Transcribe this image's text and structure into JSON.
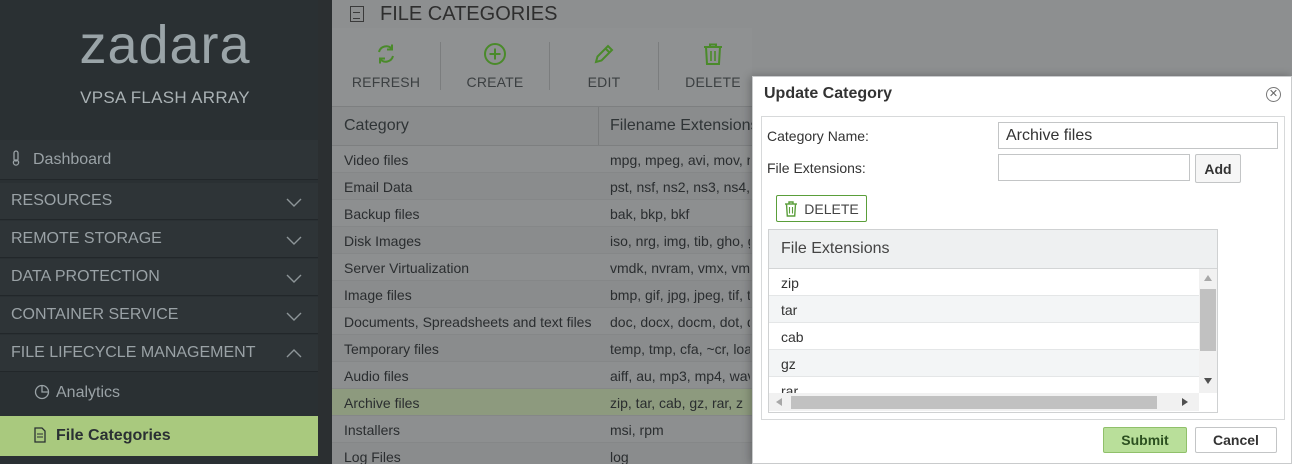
{
  "sidebar": {
    "logo": "zadara",
    "subtitle": "VPSA FLASH ARRAY",
    "items": [
      {
        "label": "Dashboard",
        "icon": "thermometer-icon"
      },
      {
        "label": "RESOURCES",
        "icon": "chevron-down-icon"
      },
      {
        "label": "REMOTE STORAGE",
        "icon": "chevron-down-icon"
      },
      {
        "label": "DATA PROTECTION",
        "icon": "chevron-down-icon"
      },
      {
        "label": "CONTAINER SERVICE",
        "icon": "chevron-down-icon"
      },
      {
        "label": "FILE LIFECYCLE MANAGEMENT",
        "icon": "chevron-up-icon"
      }
    ],
    "subitems": [
      {
        "label": "Analytics",
        "icon": "pie-chart-icon"
      },
      {
        "label": "File Categories",
        "icon": "document-icon"
      }
    ]
  },
  "main": {
    "title": "FILE CATEGORIES",
    "toolbar": [
      {
        "label": "REFRESH",
        "icon": "refresh-icon"
      },
      {
        "label": "CREATE",
        "icon": "plus-circle-icon"
      },
      {
        "label": "EDIT",
        "icon": "pencil-icon"
      },
      {
        "label": "DELETE",
        "icon": "trash-icon"
      }
    ],
    "columns": [
      "Category",
      "Filename Extensions"
    ],
    "rows": [
      {
        "category": "Video files",
        "ext": "mpg, mpeg, avi, mov, m"
      },
      {
        "category": "Email Data",
        "ext": "pst, nsf, ns2, ns3, ns4, n"
      },
      {
        "category": "Backup files",
        "ext": "bak, bkp, bkf"
      },
      {
        "category": "Disk Images",
        "ext": "iso, nrg, img, tib, gho, gh"
      },
      {
        "category": "Server Virtualization",
        "ext": "vmdk, nvram, vmx, vmxf"
      },
      {
        "category": "Image files",
        "ext": "bmp, gif, jpg, jpeg, tif, tiff"
      },
      {
        "category": "Documents, Spreadsheets and text files",
        "ext": "doc, docx, docm, dot, do"
      },
      {
        "category": "Temporary files",
        "ext": "temp, tmp, cfa, ~cr, load"
      },
      {
        "category": "Audio files",
        "ext": "aiff, au, mp3, mp4, wav, w"
      },
      {
        "category": "Archive files",
        "ext": "zip, tar, cab, gz, rar, z"
      },
      {
        "category": "Installers",
        "ext": "msi, rpm"
      },
      {
        "category": "Log Files",
        "ext": "log"
      }
    ]
  },
  "modal": {
    "title": "Update Category",
    "category_name_label": "Category Name:",
    "category_name_value": "Archive files",
    "file_ext_label": "File Extensions:",
    "file_ext_value": "",
    "add_label": "Add",
    "delete_label": "DELETE",
    "grid_header": "File Extensions",
    "extensions": [
      "zip",
      "tar",
      "cab",
      "gz",
      "rar"
    ],
    "submit_label": "Submit",
    "cancel_label": "Cancel"
  },
  "colors": {
    "accent_green": "#a9c97e",
    "sidebar_bg": "#2a3033",
    "submit_bg": "#b9df9a"
  }
}
